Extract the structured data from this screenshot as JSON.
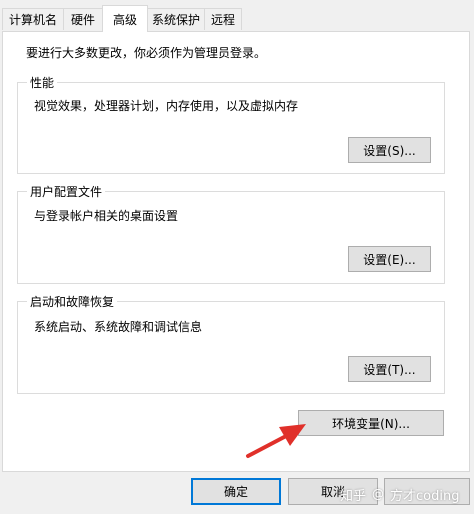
{
  "tabs": [
    {
      "label": "计算机名"
    },
    {
      "label": "硬件"
    },
    {
      "label": "高级",
      "active": true
    },
    {
      "label": "系统保护"
    },
    {
      "label": "远程"
    }
  ],
  "intro": "要进行大多数更改，你必须作为管理员登录。",
  "performance": {
    "title": "性能",
    "description": "视觉效果，处理器计划，内存使用，以及虚拟内存",
    "button": "设置(S)..."
  },
  "user_profiles": {
    "title": "用户配置文件",
    "description": "与登录帐户相关的桌面设置",
    "button": "设置(E)..."
  },
  "startup_recovery": {
    "title": "启动和故障恢复",
    "description": "系统启动、系统故障和调试信息",
    "button": "设置(T)..."
  },
  "env_button": "环境变量(N)...",
  "footer": {
    "ok": "确定",
    "cancel": "取消"
  },
  "watermark": {
    "site": "知乎",
    "at": "@",
    "author": "方才coding"
  },
  "colors": {
    "accent": "#0078d7",
    "annotation_arrow": "#e0302a"
  }
}
